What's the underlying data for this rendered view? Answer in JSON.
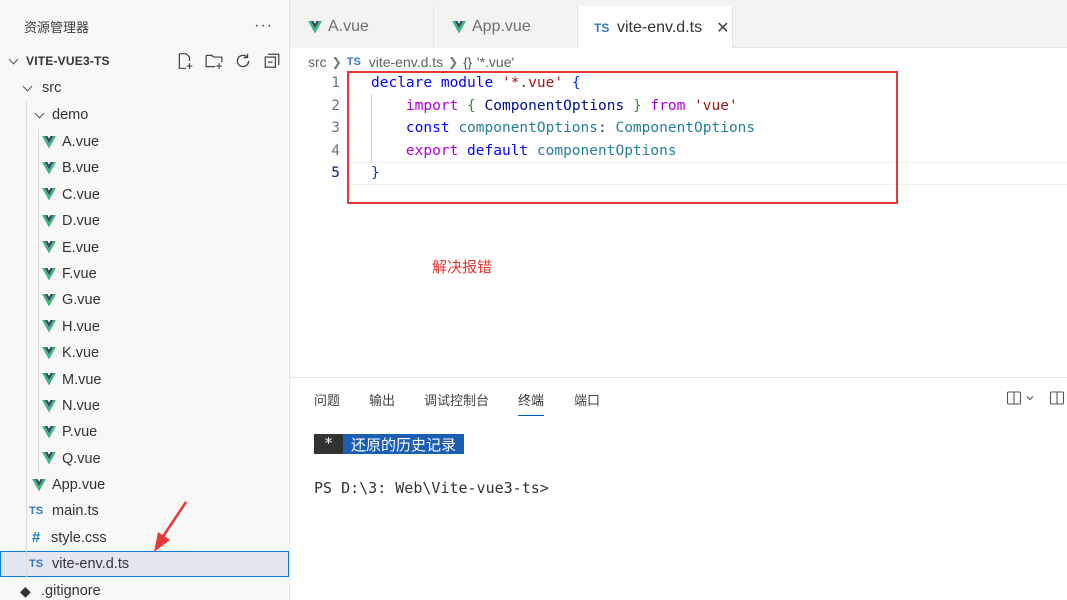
{
  "sidebar": {
    "title": "资源管理器",
    "more": "···",
    "project": "VITE-VUE3-TS",
    "tree": {
      "src": "src",
      "demo": "demo",
      "demo_files": [
        "A.vue",
        "B.vue",
        "C.vue",
        "D.vue",
        "E.vue",
        "F.vue",
        "G.vue",
        "H.vue",
        "K.vue",
        "M.vue",
        "N.vue",
        "P.vue",
        "Q.vue"
      ],
      "src_files": [
        {
          "icon": "vue-icon",
          "name": "App.vue"
        },
        {
          "icon": "ts-icon",
          "name": "main.ts"
        },
        {
          "icon": "css-icon",
          "name": "style.css"
        },
        {
          "icon": "ts-icon",
          "name": "vite-env.d.ts",
          "selected": true
        }
      ],
      "root_files": [
        {
          "icon": "git-icon",
          "name": ".gitignore"
        }
      ]
    }
  },
  "tabs": [
    {
      "icon": "vue-icon",
      "label": "A.vue"
    },
    {
      "icon": "vue-icon",
      "label": "App.vue"
    },
    {
      "icon": "ts-icon",
      "label": "vite-env.d.ts",
      "active": true,
      "close": "✕"
    }
  ],
  "icons": {
    "ts_badge": "TS",
    "css_badge": "#",
    "git_badge": "◆"
  },
  "breadcrumb": [
    "src",
    "vite-env.d.ts",
    "'*.vue'"
  ],
  "breadcrumb_symbol": "{}",
  "editor": {
    "line_numbers": [
      "1",
      "2",
      "3",
      "4",
      "5"
    ],
    "current_line": 5
  },
  "annotation": "解决报错",
  "panel": {
    "tabs": [
      "问题",
      "输出",
      "调试控制台",
      "终端",
      "端口"
    ],
    "active_tab": "终端",
    "terminal": {
      "banner_star": "*",
      "banner_text": "还原的历史记录",
      "prompt": "PS D:\\3: Web\\Vite-vue3-ts>"
    }
  },
  "colors": {
    "accent": "#005fb8",
    "annotation": "#e53935",
    "vue": "#41b883",
    "ts": "#3178c6"
  }
}
